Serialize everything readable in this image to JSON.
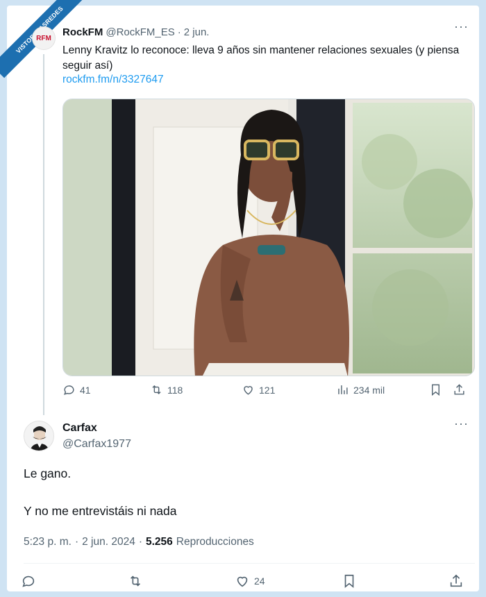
{
  "watermark": {
    "line1": "VISTOENLASREDES",
    "line2": ".com"
  },
  "quoted_tweet": {
    "avatar_text": "RFM",
    "name": "RockFM",
    "handle": "@RockFM_ES",
    "separator": "·",
    "date": "2 jun.",
    "text": "Lenny Kravitz lo reconoce: lleva 9 años sin mantener relaciones sexuales (y piensa seguir así)",
    "link": "rockfm.fm/n/3327647",
    "stats": {
      "replies": "41",
      "retweets": "118",
      "likes": "121",
      "views": "234 mil"
    }
  },
  "reply_tweet": {
    "name": "Carfax",
    "handle": "@Carfax1977",
    "text_line1": "Le gano.",
    "text_line2": "Y no me entrevistáis ni nada",
    "time": "5:23 p. m.",
    "sep1": "·",
    "date": "2 jun. 2024",
    "sep2": "·",
    "views_count": "5.256",
    "views_label": "Reproducciones",
    "stats": {
      "likes": "24"
    }
  },
  "colors": {
    "accent": "#1d9bf0",
    "muted": "#536471",
    "background": "#cfe3f3"
  }
}
